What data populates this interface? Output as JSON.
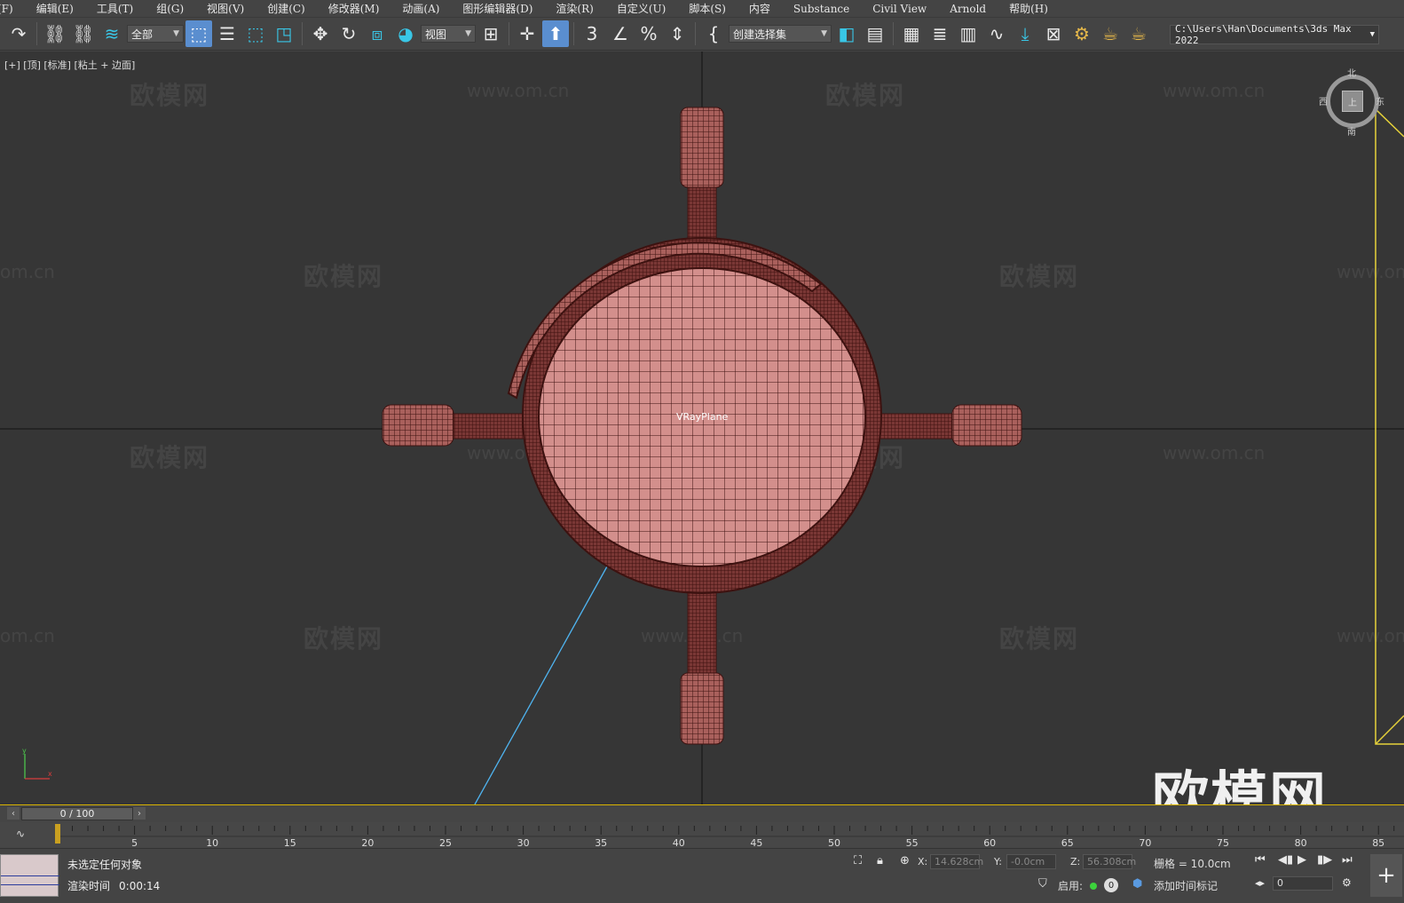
{
  "menu": [
    "(F)",
    "编辑(E)",
    "工具(T)",
    "组(G)",
    "视图(V)",
    "创建(C)",
    "修改器(M)",
    "动画(A)",
    "图形编辑器(D)",
    "渲染(R)",
    "自定义(U)",
    "脚本(S)",
    "内容",
    "Substance",
    "Civil View",
    "Arnold",
    "帮助(H)"
  ],
  "toolbar": {
    "selection_filter": "全部",
    "ref_coord": "视图",
    "named_selection": "创建选择集",
    "project_path": "C:\\Users\\Han\\Documents\\3ds Max 2022",
    "snap_label": "3"
  },
  "viewport": {
    "label": "[+] [顶] [标准] [粘土 + 边面]",
    "object_label": "VRayPlane",
    "watermark_cn": "欧模网",
    "watermark_url": "www.om.cn",
    "watermark_url_short": "om.cn",
    "watermark_big": "欧模网",
    "viewcube": {
      "face": "上",
      "north": "北",
      "south": "南",
      "east": "东",
      "west": "西"
    },
    "colors": {
      "mesh": "#8a4a48",
      "wire": "#3d1210",
      "grid": "#4a4a4a",
      "bg": "#363636",
      "camera": "#e6d23a",
      "light_line": "#4fb4f0"
    }
  },
  "timeline": {
    "frame_display": "0 / 100",
    "ticks": [
      "5",
      "10",
      "15",
      "20",
      "25",
      "30",
      "35",
      "40",
      "45",
      "50",
      "55",
      "60",
      "65",
      "70",
      "75",
      "80",
      "85"
    ]
  },
  "status": {
    "message": "未选定任何对象",
    "render_time_label": "渲染时间",
    "render_time_value": "0:00:14",
    "x_label": "X:",
    "x_value": "14.628cm",
    "y_label": "Y:",
    "y_value": "-0.0cm",
    "z_label": "Z:",
    "z_value": "56.308cm",
    "grid": "栅格 = 10.0cm",
    "enable_label": "启用:",
    "enable_count": "0",
    "add_time_tag": "添加时间标记",
    "frame_field": "0"
  }
}
